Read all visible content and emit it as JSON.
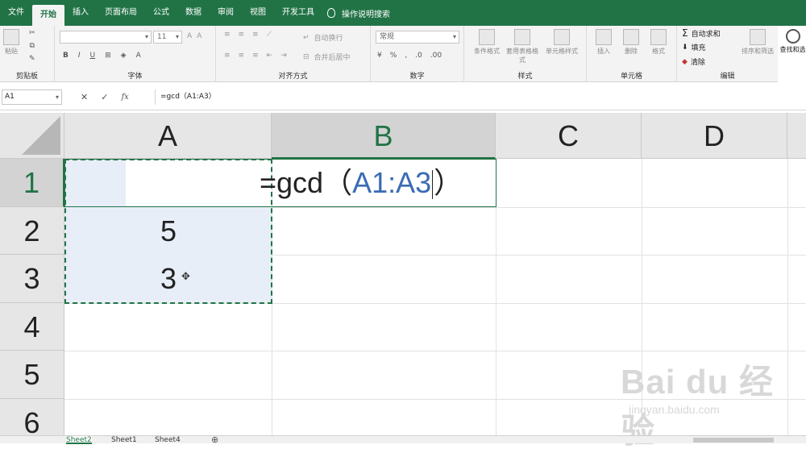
{
  "menu": {
    "tabs": [
      "文件",
      "开始",
      "插入",
      "页面布局",
      "公式",
      "数据",
      "审阅",
      "视图",
      "开发工具"
    ],
    "active_tab": "开始",
    "search_label": "操作说明搜索"
  },
  "ribbon": {
    "clipboard": {
      "label": "剪贴板",
      "paste": "粘贴"
    },
    "font": {
      "label": "字体",
      "font_size": "11",
      "bold": "B",
      "italic": "I",
      "underline": "U"
    },
    "alignment": {
      "label": "对齐方式",
      "wrap": "自动换行",
      "merge": "合并后居中"
    },
    "number": {
      "label": "数字",
      "format": "常规",
      "percent": "%",
      "comma": ","
    },
    "styles": {
      "label": "样式",
      "conditional": "条件格式",
      "table": "套用表格格式",
      "cell_styles": "单元格样式"
    },
    "cells": {
      "label": "单元格",
      "insert": "插入",
      "delete": "删除",
      "format": "格式"
    },
    "editing": {
      "label": "编辑",
      "autosum": "自动求和",
      "fill": "填充",
      "clear": "清除",
      "sort": "排序和筛选",
      "find": "查找和选"
    }
  },
  "formula_bar": {
    "name_box": "A1",
    "cancel": "✕",
    "confirm": "✓",
    "fx": "fx",
    "formula": "=gcd（A1:A3）"
  },
  "grid": {
    "columns": [
      "A",
      "B",
      "C",
      "D"
    ],
    "selected_column": "B",
    "rows": [
      "1",
      "2",
      "3",
      "4",
      "5",
      "6"
    ],
    "selected_row": "1",
    "cell_A2": "5",
    "cell_A3": "3",
    "formula_prefix": "=gcd（",
    "formula_ref": "A1:A3",
    "formula_suffix": "）"
  },
  "sheets": {
    "tabs": [
      "Sheet2",
      "Sheet1",
      "Sheet4"
    ],
    "active": "Sheet2",
    "add": "⊕"
  },
  "watermark": {
    "brand": "Bai du 经验",
    "url": "jingyan.baidu.com"
  },
  "colors": {
    "accent": "#217346",
    "selection_fill": "#e7eef8",
    "reference_blue": "#3a6bb4"
  }
}
